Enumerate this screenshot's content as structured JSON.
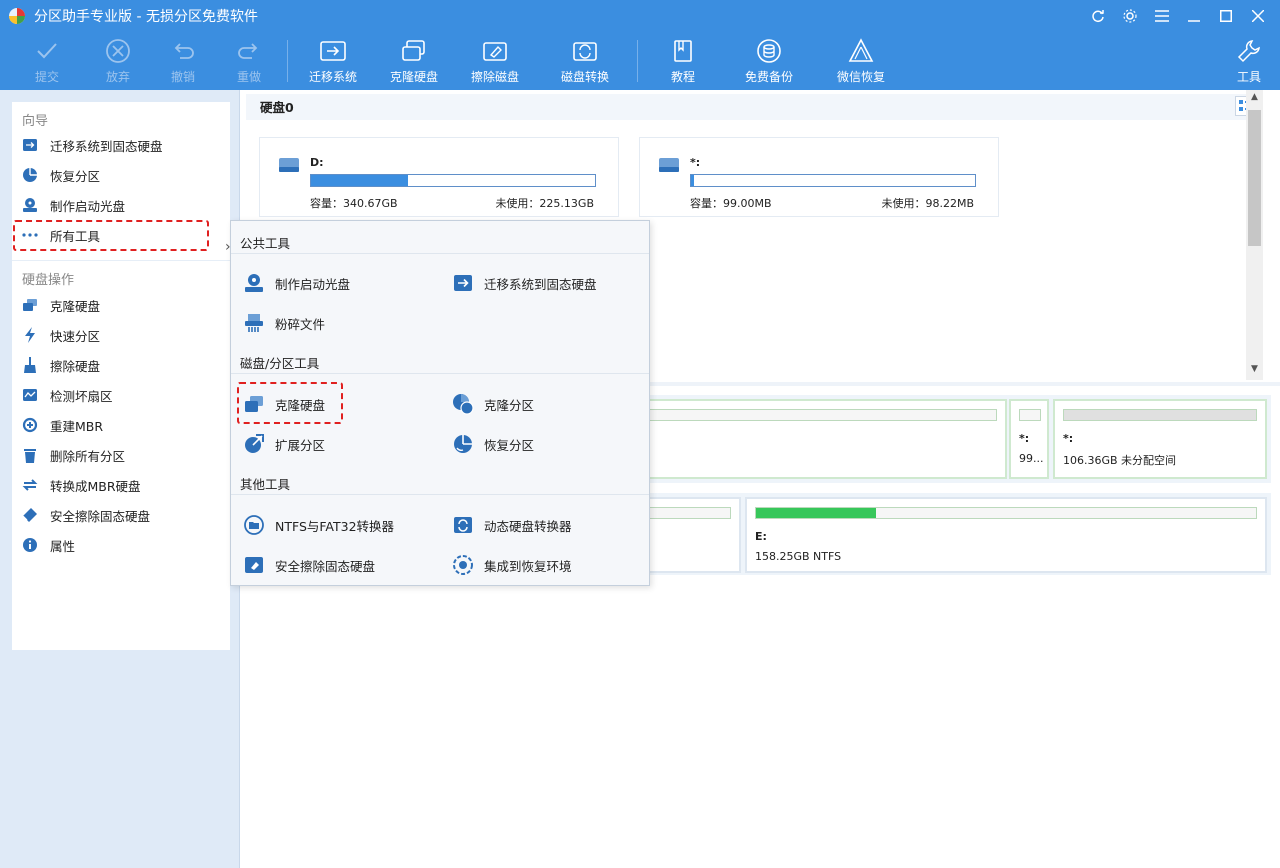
{
  "window": {
    "title": "分区助手专业版 - 无损分区免费软件"
  },
  "toolbar": {
    "commit": "提交",
    "discard": "放弃",
    "undo": "撤销",
    "redo": "重做",
    "migrate": "迁移系统",
    "clone_disk": "克隆硬盘",
    "wipe_disk": "擦除磁盘",
    "disk_convert": "磁盘转换",
    "tutorial": "教程",
    "free_backup": "免费备份",
    "wechat_recovery": "微信恢复",
    "tools": "工具"
  },
  "sidebar": {
    "wizard_title": "向导",
    "wizard_items": [
      "迁移系统到固态硬盘",
      "恢复分区",
      "制作启动光盘",
      "所有工具"
    ],
    "disk_ops_title": "硬盘操作",
    "disk_ops_items": [
      "克隆硬盘",
      "快速分区",
      "擦除硬盘",
      "检测坏扇区",
      "重建MBR",
      "删除所有分区",
      "转换成MBR硬盘",
      "安全擦除固态硬盘",
      "属性"
    ]
  },
  "disk": {
    "name": "硬盘0",
    "partitions": [
      {
        "label": "D:",
        "capacity": "容量：340.67GB",
        "free": "未使用：225.13GB",
        "used_fraction": 0.34
      },
      {
        "label": "*:",
        "capacity": "容量：99.00MB",
        "free": "未使用：98.22MB",
        "used_fraction": 0.01
      }
    ]
  },
  "disk_map": {
    "row1": [
      {
        "label": "*:",
        "desc": "99..."
      },
      {
        "label": "*:",
        "desc": "106.36GB 未分配空间"
      }
    ],
    "row2": [
      {
        "label": "E:",
        "desc": "158.25GB NTFS",
        "used_fraction": 0.24
      }
    ]
  },
  "menu": {
    "public_tools": "公共工具",
    "public_items": [
      "制作启动光盘",
      "迁移系统到固态硬盘",
      "粉碎文件"
    ],
    "disk_tools": "磁盘/分区工具",
    "disk_items": [
      "克隆硬盘",
      "克隆分区",
      "扩展分区",
      "恢复分区"
    ],
    "other_tools": "其他工具",
    "other_items": [
      "NTFS与FAT32转换器",
      "动态硬盘转换器",
      "安全擦除固态硬盘",
      "集成到恢复环境"
    ]
  },
  "colors": {
    "accent": "#3b8ee0",
    "highlight": "#e02020",
    "used_green": "#37c75a"
  }
}
